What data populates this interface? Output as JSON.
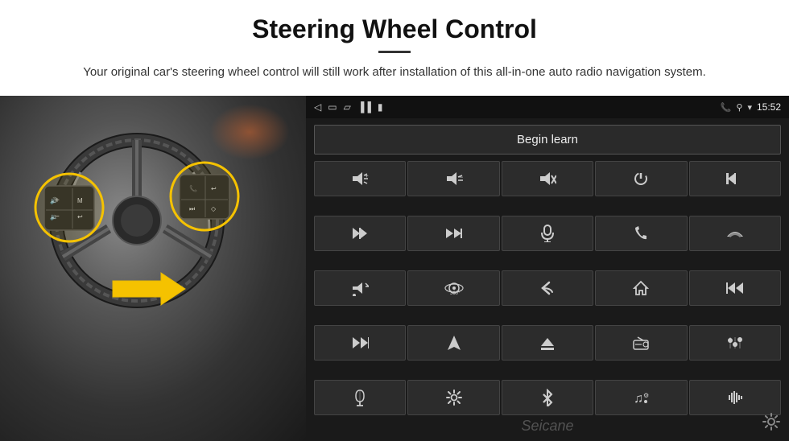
{
  "header": {
    "title": "Steering Wheel Control",
    "subtitle": "Your original car's steering wheel control will still work after installation of this all-in-one auto radio navigation system."
  },
  "android_screen": {
    "status_bar": {
      "time": "15:52",
      "icons": [
        "back",
        "home",
        "recents",
        "signal",
        "wifi",
        "phone",
        "location",
        "wifi2"
      ]
    },
    "begin_learn_label": "Begin learn",
    "controls": [
      {
        "id": "vol-up",
        "symbol": "🔊+"
      },
      {
        "id": "vol-down",
        "symbol": "🔉−"
      },
      {
        "id": "mute",
        "symbol": "🔇"
      },
      {
        "id": "power",
        "symbol": "⏻"
      },
      {
        "id": "prev-track",
        "symbol": "⏮"
      },
      {
        "id": "next",
        "symbol": "⏭"
      },
      {
        "id": "ff",
        "symbol": "⏩"
      },
      {
        "id": "mic",
        "symbol": "🎤"
      },
      {
        "id": "phone",
        "symbol": "📞"
      },
      {
        "id": "hang-up",
        "symbol": "↩"
      },
      {
        "id": "speaker",
        "symbol": "🔔"
      },
      {
        "id": "cam360",
        "symbol": "360"
      },
      {
        "id": "back",
        "symbol": "↩"
      },
      {
        "id": "home",
        "symbol": "⌂"
      },
      {
        "id": "rew",
        "symbol": "⏮"
      },
      {
        "id": "ff2",
        "symbol": "⏭"
      },
      {
        "id": "nav",
        "symbol": "▶"
      },
      {
        "id": "eject",
        "symbol": "⏏"
      },
      {
        "id": "radio",
        "symbol": "📻"
      },
      {
        "id": "equalizer",
        "symbol": "🎛"
      },
      {
        "id": "mic2",
        "symbol": "🎙"
      },
      {
        "id": "settings2",
        "symbol": "⚙"
      },
      {
        "id": "bt",
        "symbol": "⚡"
      },
      {
        "id": "music",
        "symbol": "♫"
      },
      {
        "id": "eq2",
        "symbol": "📊"
      }
    ],
    "seicane_text": "Seicane"
  }
}
